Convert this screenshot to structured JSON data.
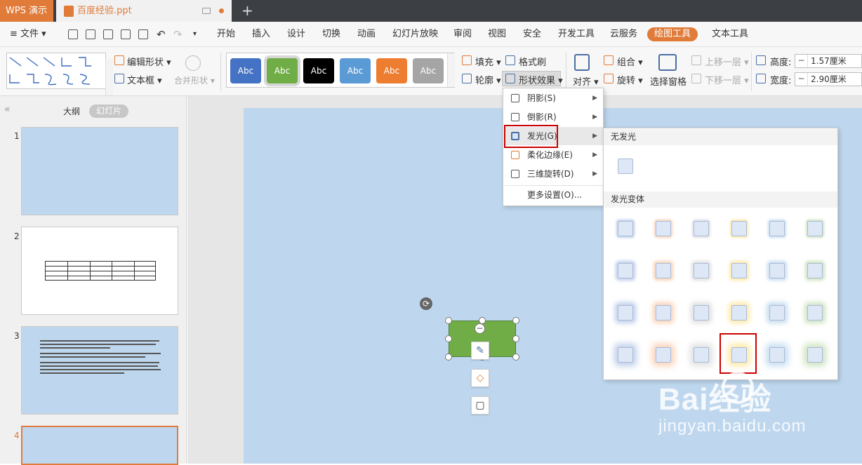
{
  "titlebar": {
    "app_name": "WPS 演示",
    "doc_name": "百度经验.ppt",
    "new_tab": "+"
  },
  "menubar": {
    "file": "≡ 文件 ▾",
    "tabs": [
      "开始",
      "插入",
      "设计",
      "切换",
      "动画",
      "幻灯片放映",
      "审阅",
      "视图",
      "安全",
      "开发工具",
      "云服务",
      "绘图工具",
      "文本工具"
    ],
    "active_tab": "绘图工具"
  },
  "ribbon": {
    "edit_shape": "编辑形状 ▾",
    "text_box": "文本框 ▾",
    "merge_shape": "合并形状 ▾",
    "style_buttons": [
      {
        "label": "Abc",
        "color": "#4472c4"
      },
      {
        "label": "Abc",
        "color": "#70ad47"
      },
      {
        "label": "Abc",
        "color": "#000000"
      },
      {
        "label": "Abc",
        "color": "#5b9bd5"
      },
      {
        "label": "Abc",
        "color": "#ed7d31"
      },
      {
        "label": "Abc",
        "color": "#a5a5a5"
      }
    ],
    "fill": "填充 ▾",
    "format_painter": "格式刷",
    "outline": "轮廓 ▾",
    "shape_effects": "形状效果 ▾",
    "align": "对齐 ▾",
    "group": "组合 ▾",
    "rotate": "旋转 ▾",
    "selection_pane": "选择窗格",
    "bring_forward": "上移一层 ▾",
    "send_backward": "下移一层 ▾",
    "height_label": "高度:",
    "height_value": "1.57厘米",
    "width_label": "宽度:",
    "width_value": "2.90厘米"
  },
  "left_panel": {
    "collapse": "«",
    "outline_tab": "大纲",
    "slides_tab": "幻灯片",
    "slide_numbers": [
      "1",
      "2",
      "3",
      "4"
    ]
  },
  "dropdown": {
    "items": [
      {
        "label": "阴影(S)"
      },
      {
        "label": "倒影(R)"
      },
      {
        "label": "发光(G)"
      },
      {
        "label": "柔化边缘(E)"
      },
      {
        "label": "三维旋转(D)"
      },
      {
        "label": "更多设置(O)..."
      }
    ]
  },
  "glow_panel": {
    "no_glow_title": "无发光",
    "variants_title": "发光变体",
    "glow_colors": [
      "#4472c4",
      "#ed7d31",
      "#a5a5a5",
      "#ffc000",
      "#5b9bd5",
      "#70ad47"
    ]
  },
  "watermark": {
    "logo": "Bai经验",
    "url": "jingyan.baidu.com"
  }
}
